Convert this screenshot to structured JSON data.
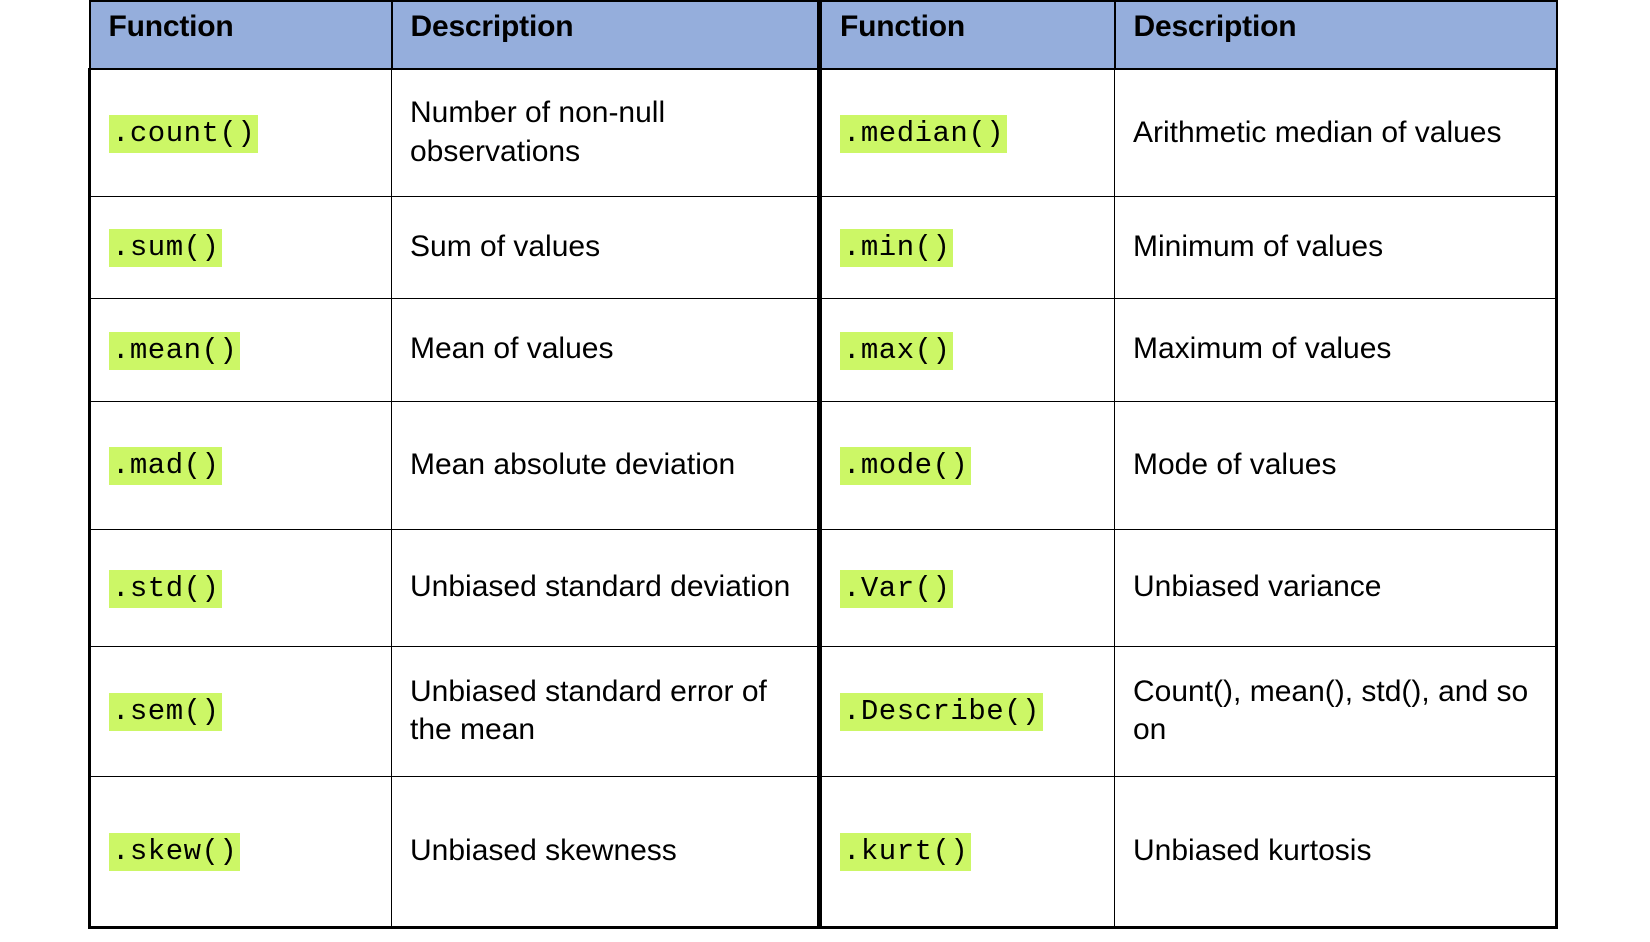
{
  "table": {
    "headers": {
      "function": "Function",
      "description": "Description"
    },
    "rows": [
      {
        "left_function": ".count()",
        "left_description": "Number of non-null observations",
        "right_function": ".median()",
        "right_description": "Arithmetic median of values"
      },
      {
        "left_function": ".sum()",
        "left_description": "Sum of values",
        "right_function": ".min()",
        "right_description": "Minimum of values"
      },
      {
        "left_function": ".mean()",
        "left_description": "Mean of values",
        "right_function": ".max()",
        "right_description": "Maximum of values"
      },
      {
        "left_function": ".mad()",
        "left_description": "Mean absolute deviation",
        "right_function": ".mode()",
        "right_description": "Mode of values"
      },
      {
        "left_function": ".std()",
        "left_description": "Unbiased standard deviation",
        "right_function": ".Var()",
        "right_description": "Unbiased variance"
      },
      {
        "left_function": ".sem()",
        "left_description": "Unbiased standard error of the mean",
        "right_function": ".Describe()",
        "right_description": "Count(), mean(), std(), and so on"
      },
      {
        "left_function": ".skew()",
        "left_description": "Unbiased skewness",
        "right_function": ".kurt()",
        "right_description": "Unbiased kurtosis"
      }
    ]
  },
  "colors": {
    "header_background": "#95aedc",
    "code_highlight": "#ccf766",
    "border": "#000000",
    "text": "#000000",
    "page_background": "#ffffff"
  }
}
